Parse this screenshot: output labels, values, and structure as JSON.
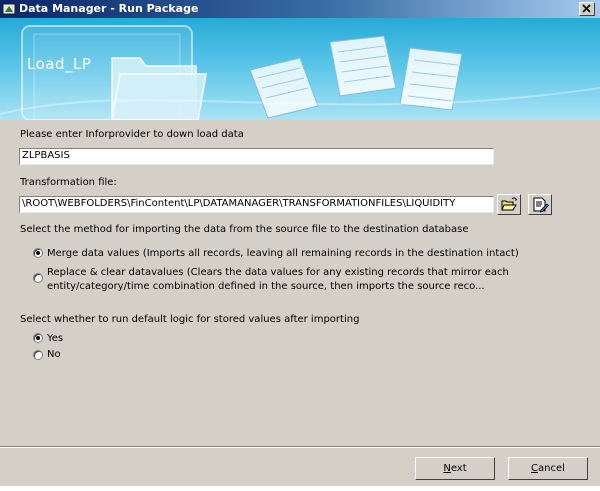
{
  "window": {
    "title": "Data Manager - Run Package",
    "close_glyph": "✕"
  },
  "banner": {
    "title": "Load_LP"
  },
  "infoprovider": {
    "label": "Please enter Inforprovider to down load data",
    "value": "ZLPBASIS"
  },
  "transformation": {
    "label": "Transformation file:",
    "value": "\\ROOT\\WEBFOLDERS\\FinContent\\LP\\DATAMANAGER\\TRANSFORMATIONFILES\\LIQUIDITY",
    "browse_icon": "open-folder-icon",
    "edit_icon": "edit-document-icon"
  },
  "import_method": {
    "label": "Select the method for importing the data from the source file to the destination database",
    "options": [
      {
        "label": "Merge data values (Imports all records, leaving all remaining records in the destination intact)",
        "checked": true
      },
      {
        "label_line1": "Replace & clear datavalues (Clears the data values for any existing records that mirror each",
        "label_line2": "entity/category/time combination defined in the source, then imports the source reco...",
        "checked": false
      }
    ]
  },
  "default_logic": {
    "label": "Select whether to run default logic for stored values after importing",
    "options": [
      {
        "label": "Yes",
        "checked": true
      },
      {
        "label": "No",
        "checked": false
      }
    ]
  },
  "buttons": {
    "next_mnemonic": "N",
    "next_rest": "ext",
    "cancel_mnemonic": "C",
    "cancel_rest": "ancel"
  }
}
